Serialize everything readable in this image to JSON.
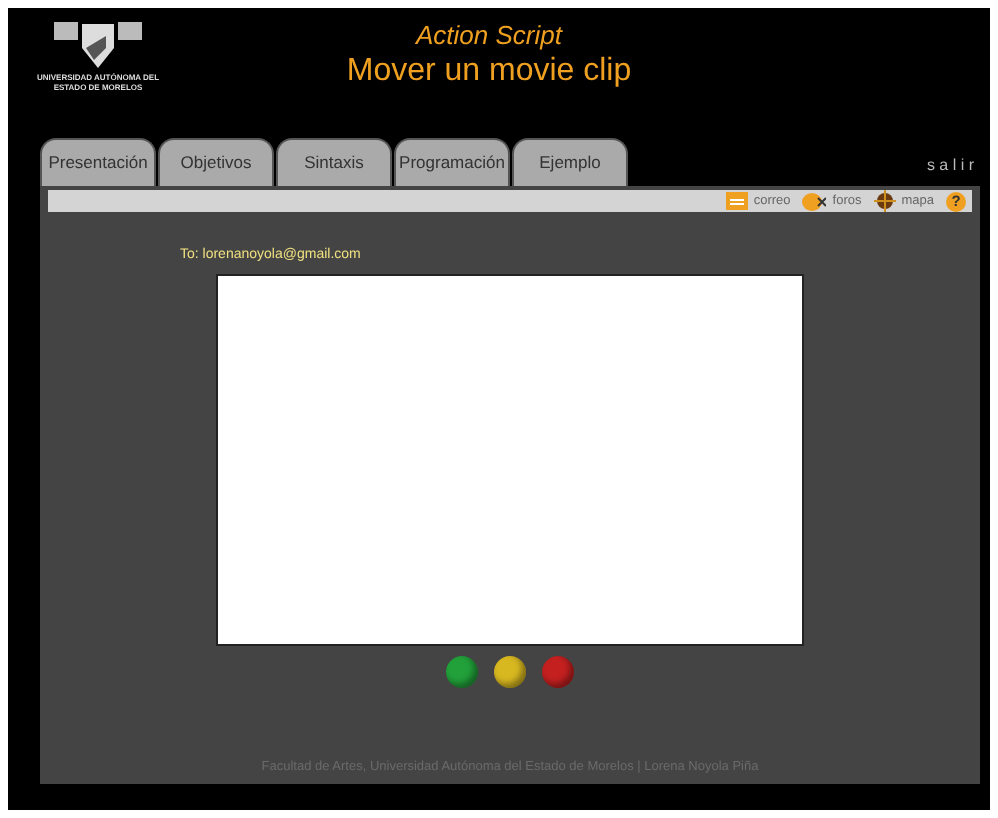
{
  "header": {
    "logo_lines": [
      "UNIVERSIDAD AUTÓNOMA DEL",
      "ESTADO DE MORELOS"
    ],
    "subtitle": "Action Script",
    "title": "Mover un movie clip"
  },
  "tabs": [
    {
      "label": "Presentación",
      "selected": false
    },
    {
      "label": "Objetivos",
      "selected": false
    },
    {
      "label": "Sintaxis",
      "selected": false
    },
    {
      "label": "Programación",
      "selected": false
    },
    {
      "label": "Ejemplo",
      "selected": false
    }
  ],
  "exit_link": "s a l i r",
  "toolbar": [
    {
      "kind": "mail",
      "label": "correo"
    },
    {
      "kind": "forum",
      "label": "foros"
    },
    {
      "kind": "map",
      "label": "mapa"
    },
    {
      "kind": "help",
      "label": "?"
    }
  ],
  "email_to": "To: lorenanoyola@gmail.com",
  "buttons": [
    {
      "color": "#22a03a"
    },
    {
      "color": "#d8b820"
    },
    {
      "color": "#c42020"
    }
  ],
  "footer": "Facultad de Artes, Universidad Autónoma del Estado de Morelos | Lorena Noyola Piña"
}
